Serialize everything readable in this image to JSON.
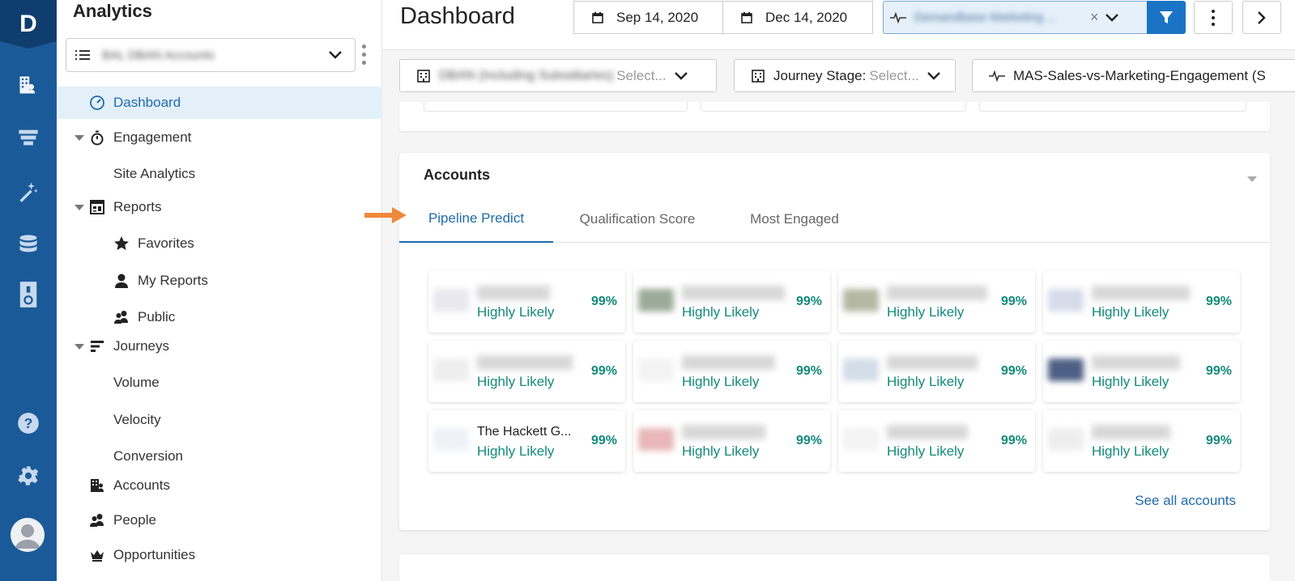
{
  "nav": {
    "title": "Analytics",
    "account_list": "BAL DBAN Accounts",
    "items": [
      {
        "label": "Dashboard"
      },
      {
        "label": "Engagement"
      },
      {
        "label": "Site Analytics"
      },
      {
        "label": "Reports"
      },
      {
        "label": "Favorites"
      },
      {
        "label": "My Reports"
      },
      {
        "label": "Public"
      },
      {
        "label": "Journeys"
      },
      {
        "label": "Volume"
      },
      {
        "label": "Velocity"
      },
      {
        "label": "Conversion"
      },
      {
        "label": "Accounts"
      },
      {
        "label": "People"
      },
      {
        "label": "Opportunities"
      }
    ]
  },
  "header": {
    "title": "Dashboard",
    "start_date": "Sep 14, 2020",
    "end_date": "Dec 14, 2020",
    "segment": "Demandbase Marketing ...",
    "clear": "×"
  },
  "filters": {
    "org": "DBAN (Including Subsidiaries)",
    "org_placeholder": "Select...",
    "journey_label": "Journey Stage:",
    "journey_placeholder": "Select...",
    "engagement": "MAS-Sales-vs-Marketing-Engagement (S"
  },
  "accounts_card": {
    "title": "Accounts",
    "tabs": [
      "Pipeline Predict",
      "Qualification Score",
      "Most Engaged"
    ],
    "see_all": "See all accounts",
    "status_label": "Highly Likely",
    "percent": "99%",
    "visible_name": "The Hackett G...",
    "logo_colors": [
      "#e8e8ee",
      "#9cab98",
      "#b4b8a4",
      "#d6dbea",
      "#eeeeee",
      "#f3f3f3",
      "#d3dde8",
      "#4c5f84",
      "#eef1f6",
      "#e9b7b7",
      "#f3f3f3",
      "#eeeeee"
    ]
  },
  "colors": {
    "rail": "#1b5a98",
    "accent": "#1f6aad",
    "likely_green": "#138a7a",
    "arrow": "#f0883a"
  }
}
